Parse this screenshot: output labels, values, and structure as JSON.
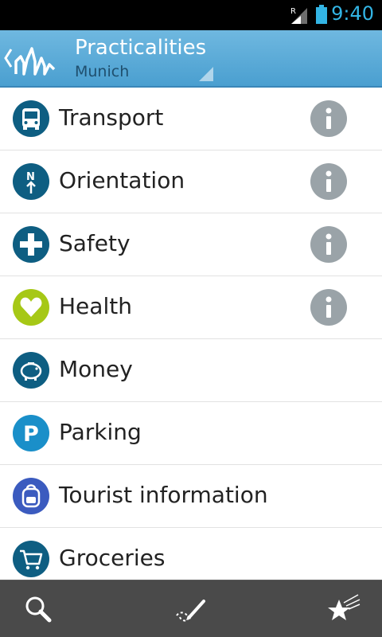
{
  "status_bar": {
    "time": "9:40",
    "roaming_mark": "R",
    "icons": [
      "signal-icon",
      "battery-icon"
    ]
  },
  "action_bar": {
    "title": "Practicalities",
    "subtitle": "Munich"
  },
  "colors": {
    "accent": "#4a9fd0",
    "dark_teal": "#0e5e82",
    "blue": "#1a8fc9",
    "green": "#a6c816",
    "indigo": "#3b5bbf",
    "info_grey": "#9aa3a8"
  },
  "items": [
    {
      "label": "Transport",
      "icon": "bus-icon",
      "has_info": true
    },
    {
      "label": "Orientation",
      "icon": "compass-north-icon",
      "has_info": true
    },
    {
      "label": "Safety",
      "icon": "cross-icon",
      "has_info": true
    },
    {
      "label": "Health",
      "icon": "heart-icon",
      "has_info": true
    },
    {
      "label": "Money",
      "icon": "piggy-bank-icon",
      "has_info": false
    },
    {
      "label": "Parking",
      "icon": "parking-icon",
      "has_info": false
    },
    {
      "label": "Tourist information",
      "icon": "backpack-icon",
      "has_info": false
    },
    {
      "label": "Groceries",
      "icon": "cart-icon",
      "has_info": false
    }
  ],
  "bottom_bar": {
    "buttons": [
      "search-icon",
      "route-edit-icon",
      "favorites-icon"
    ]
  }
}
